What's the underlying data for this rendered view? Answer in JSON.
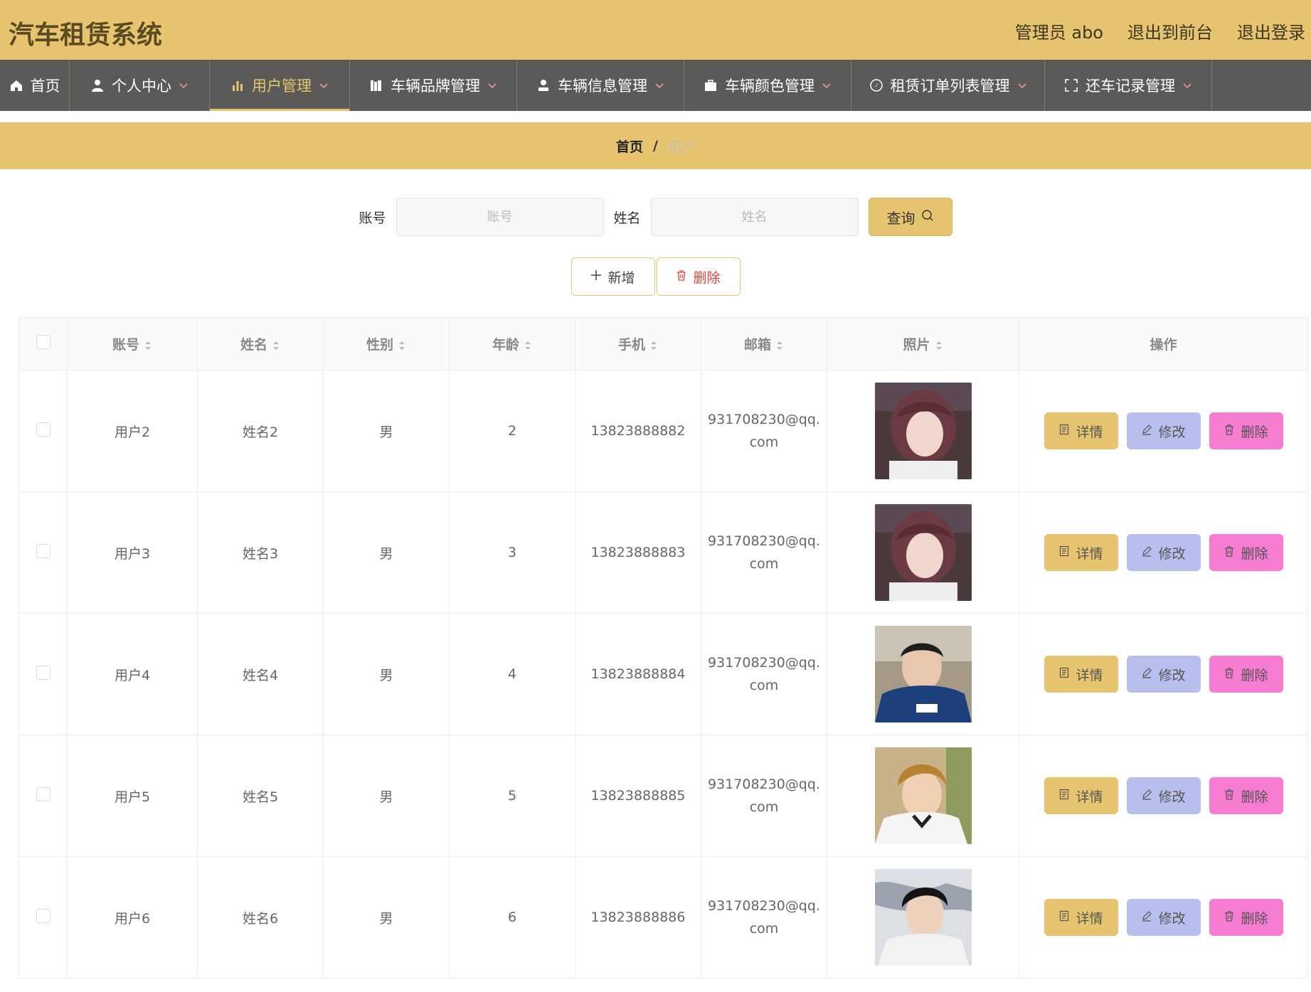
{
  "header": {
    "title": "汽车租赁系统",
    "admin_label": "管理员 abo",
    "to_frontend": "退出到前台",
    "logout": "退出登录"
  },
  "nav": [
    {
      "label": "首页",
      "icon": "home-icon",
      "dropdown": false,
      "active": false
    },
    {
      "label": "个人中心",
      "icon": "user-icon",
      "dropdown": true,
      "active": false
    },
    {
      "label": "用户管理",
      "icon": "bar-chart-icon",
      "dropdown": true,
      "active": true
    },
    {
      "label": "车辆品牌管理",
      "icon": "books-icon",
      "dropdown": true,
      "active": false
    },
    {
      "label": "车辆信息管理",
      "icon": "person-icon",
      "dropdown": true,
      "active": false
    },
    {
      "label": "车辆颜色管理",
      "icon": "briefcase-icon",
      "dropdown": true,
      "active": false
    },
    {
      "label": "租赁订单列表管理",
      "icon": "compass-icon",
      "dropdown": true,
      "active": false
    },
    {
      "label": "还车记录管理",
      "icon": "fullscreen-icon",
      "dropdown": true,
      "active": false
    }
  ],
  "breadcrumb": {
    "home": "首页",
    "separator": "/",
    "current": "用户"
  },
  "search": {
    "account_label": "账号",
    "account_placeholder": "账号",
    "name_label": "姓名",
    "name_placeholder": "姓名",
    "query_label": "查询"
  },
  "actions": {
    "add_label": "新增",
    "delete_label": "删除"
  },
  "table": {
    "columns": [
      "账号",
      "姓名",
      "性别",
      "年龄",
      "手机",
      "邮箱",
      "照片",
      "操作"
    ],
    "rows": [
      {
        "account": "用户2",
        "name": "姓名2",
        "gender": "男",
        "age": "2",
        "phone": "13823888882",
        "email": "931708230@qq.com",
        "photo": "girl-avatar"
      },
      {
        "account": "用户3",
        "name": "姓名3",
        "gender": "男",
        "age": "3",
        "phone": "13823888883",
        "email": "931708230@qq.com",
        "photo": "girl-avatar"
      },
      {
        "account": "用户4",
        "name": "姓名4",
        "gender": "男",
        "age": "4",
        "phone": "13823888884",
        "email": "931708230@qq.com",
        "photo": "boy-avatar-blue"
      },
      {
        "account": "用户5",
        "name": "姓名5",
        "gender": "男",
        "age": "5",
        "phone": "13823888885",
        "email": "931708230@qq.com",
        "photo": "boy-avatar-blond"
      },
      {
        "account": "用户6",
        "name": "姓名6",
        "gender": "男",
        "age": "6",
        "phone": "13823888886",
        "email": "931708230@qq.com",
        "photo": "boy-avatar-dark"
      }
    ],
    "row_actions": {
      "detail": "详情",
      "edit": "修改",
      "delete": "删除"
    }
  },
  "colors": {
    "primary": "#e7c46f",
    "nav_bg": "#5b5a58",
    "edit_btn": "#b8bfec",
    "delete_btn": "#f57cd0",
    "danger_text": "#e0433f"
  }
}
